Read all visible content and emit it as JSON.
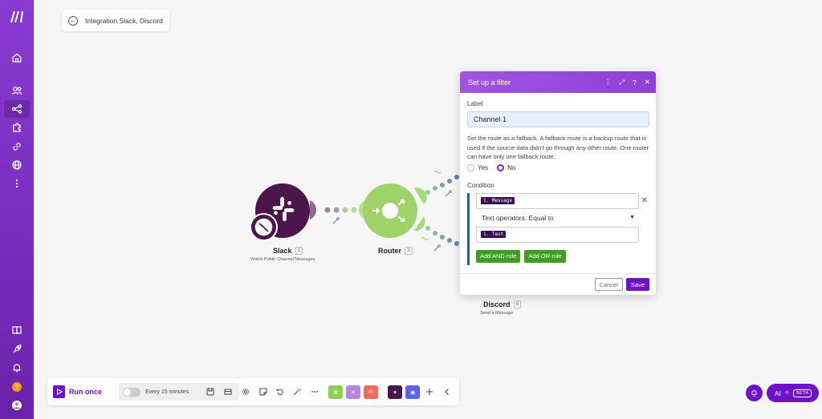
{
  "scenario": {
    "title": "Integration Slack, Discord"
  },
  "modules": {
    "slack": {
      "name": "Slack",
      "number": "1",
      "subtitle": "Watch Public Channel Messages"
    },
    "router": {
      "name": "Router",
      "number": "3"
    },
    "discord": {
      "name": "Discord",
      "number": "6",
      "subtitle": "Send a Message"
    }
  },
  "filter_panel": {
    "title": "Set up a filter",
    "label_caption": "Label",
    "label_value": "Channel 1",
    "fallback_help": "Set the route as a fallback. A fallback route is a backup route that is used if the source data didn't go through any other route. One router can have only one fallback route.",
    "radio_yes": "Yes",
    "radio_no": "No",
    "selected_radio": "No",
    "condition_caption": "Condition",
    "condition": {
      "left_operand": "1. Message",
      "operator": "Text operators: Equal to",
      "right_operand": "1. Text"
    },
    "add_and_rule": "Add AND rule",
    "add_or_rule": "Add OR rule",
    "cancel": "Cancel",
    "save": "Save"
  },
  "toolbar": {
    "run_once": "Run once",
    "schedule": "Every 15 minutes"
  },
  "ai": {
    "label": "AI",
    "badge": "BETA"
  },
  "colors": {
    "brand": "#6d12c9",
    "sidebar": "#7a2fc0",
    "panel_header": "#9a4ddc",
    "slack": "#4a154b",
    "router": "#9fd36a",
    "discord": "#5865f2",
    "green_button": "#3f9e1d",
    "condition_bar": "#1e5fa8"
  }
}
